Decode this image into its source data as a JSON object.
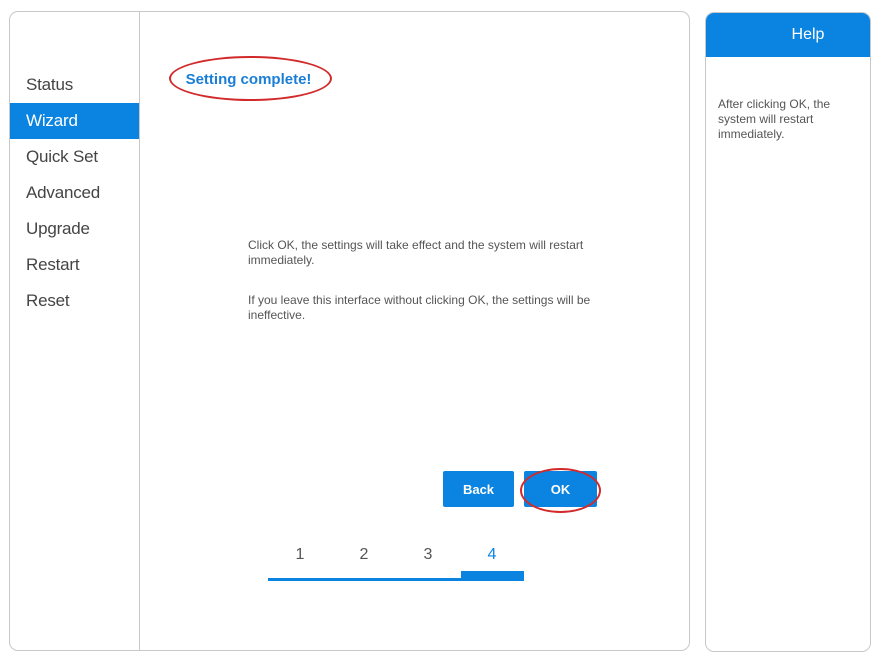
{
  "sidebar": {
    "items": [
      {
        "label": "Status"
      },
      {
        "label": "Wizard"
      },
      {
        "label": "Quick Set"
      },
      {
        "label": "Advanced"
      },
      {
        "label": "Upgrade"
      },
      {
        "label": "Restart"
      },
      {
        "label": "Reset"
      }
    ],
    "active": "Wizard"
  },
  "main": {
    "title": "Setting complete!",
    "message1": "Click OK, the settings will take effect and the system will restart immediately.",
    "message2": "If you leave this interface without clicking OK, the settings will be ineffective.",
    "back_label": "Back",
    "ok_label": "OK",
    "steps": [
      "1",
      "2",
      "3",
      "4"
    ],
    "current_step": 4
  },
  "help": {
    "title": "Help",
    "text": "After clicking OK, the system will restart immediately."
  },
  "colors": {
    "accent": "#0a84e0",
    "highlight": "#d22a2a"
  }
}
